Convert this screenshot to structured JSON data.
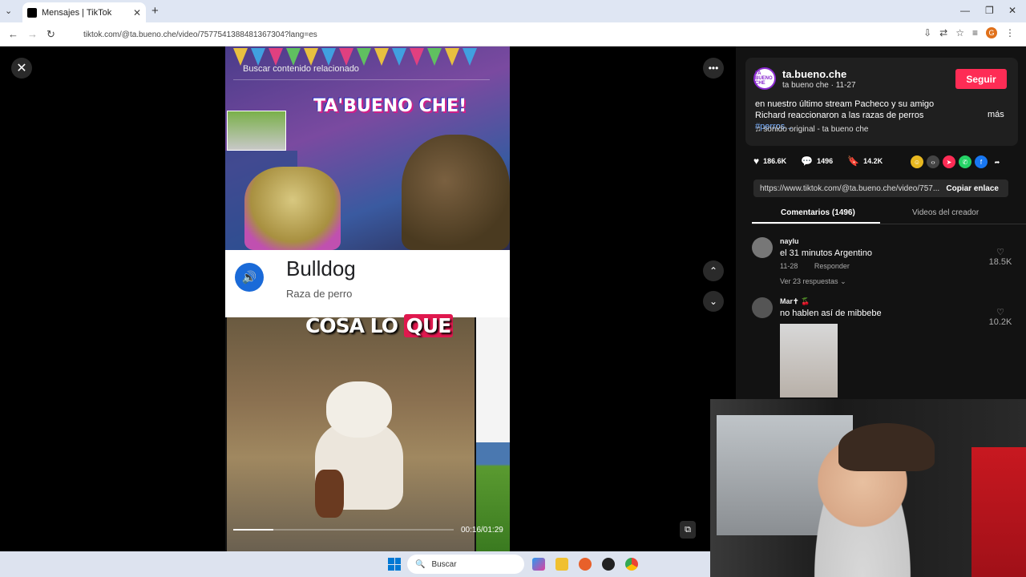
{
  "browser": {
    "tab_title": "Mensajes | TikTok",
    "url": "tiktok.com/@ta.bueno.che/video/7577541388481367304?lang=es"
  },
  "video": {
    "search_placeholder": "Buscar contenido relacionado",
    "logo_text": "TA'BUENO CHE!",
    "card_title": "Bulldog",
    "card_subtitle": "Raza de perro",
    "caption_plain": "COSA LO",
    "caption_highlight": "QUE",
    "progress_fraction": 0.18,
    "time": "00:16/01:29"
  },
  "panel": {
    "creator_badge": "TA BUENO CHE",
    "creator_name": "ta.bueno.che",
    "creator_sub": "ta bueno che · 11-27",
    "follow_label": "Seguir",
    "description": "en nuestro último stream Pacheco y su amigo Richard reaccionaron a las razas de perros",
    "hashtag": "#perros...",
    "more_label": "más",
    "music": "sonido original - ta bueno che",
    "likes": "186.6K",
    "comments_count": "1496",
    "saves": "14.2K",
    "share_url": "https://www.tiktok.com/@ta.bueno.che/video/757...",
    "copy_label": "Copiar enlace",
    "tab_comments": "Comentarios (1496)",
    "tab_creator": "Videos del creador"
  },
  "comments": [
    {
      "user": "naylu",
      "text": "el 31 minutos Argentino",
      "date": "11-28",
      "reply": "Responder",
      "replies": "Ver 23 respuestas",
      "likes": "18.5K"
    },
    {
      "user": "Mar✝︎ 🍒",
      "text": "no hablen así de mibbebe",
      "likes": "10.2K"
    }
  ],
  "taskbar": {
    "search_label": "Buscar"
  },
  "colors": {
    "follow": "#fe2c55",
    "hashtag": "#7ab0ff",
    "speaker": "#1a6ad8",
    "caption_highlight": "#e0184e"
  }
}
